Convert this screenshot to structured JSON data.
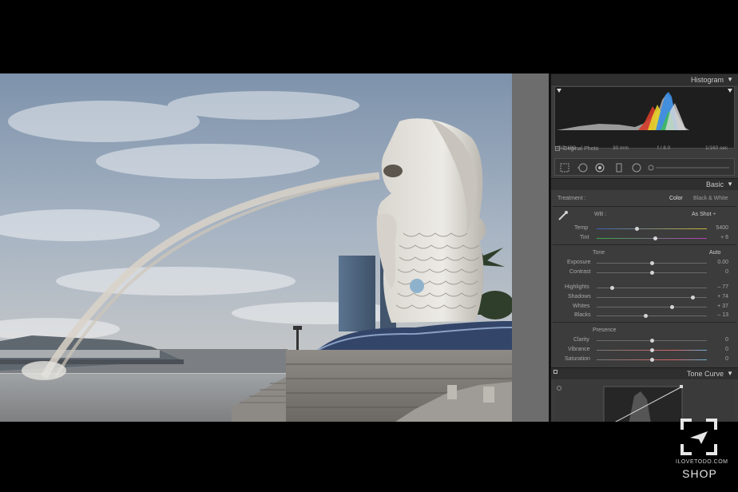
{
  "panel": {
    "histogram": {
      "title": "Histogram",
      "iso": "ISO 100",
      "focal_length": "30 mm",
      "aperture": "f / 8.0",
      "shutter": "1/160 sec",
      "original_photo_label": "Original Photo"
    },
    "basic": {
      "title": "Basic",
      "treatment_label": "Treatment :",
      "treatment_color": "Color",
      "treatment_bw": "Black & White",
      "wb_label": "WB :",
      "wb_value": "As Shot ÷",
      "temp": {
        "label": "Temp",
        "value": "5400",
        "level": 0.36
      },
      "tint": {
        "label": "Tint",
        "value": "+ 6",
        "level": 0.53
      },
      "tone_title": "Tone",
      "auto_label": "Auto",
      "exposure": {
        "label": "Exposure",
        "value": "0.00",
        "level": 0.5
      },
      "contrast": {
        "label": "Contrast",
        "value": "0",
        "level": 0.5
      },
      "highlights": {
        "label": "Highlights",
        "value": "– 77",
        "level": 0.14
      },
      "shadows": {
        "label": "Shadows",
        "value": "+ 74",
        "level": 0.87
      },
      "whites": {
        "label": "Whites",
        "value": "+ 37",
        "level": 0.68
      },
      "blacks": {
        "label": "Blacks",
        "value": "– 13",
        "level": 0.44
      },
      "presence_title": "Presence",
      "clarity": {
        "label": "Clarity",
        "value": "0",
        "level": 0.5
      },
      "vibrance": {
        "label": "Vibrance",
        "value": "0",
        "level": 0.5
      },
      "saturation": {
        "label": "Saturation",
        "value": "0",
        "level": 0.5
      }
    },
    "tone_curve": {
      "title": "Tone Curve"
    }
  },
  "watermark": {
    "domain": "ILOVETODO.COM",
    "shop": "SHOP"
  },
  "colors": {
    "panel_bg": "#3c3c3c",
    "header_bg": "#2f2f2f",
    "strip_gray": "#6d6d6d"
  }
}
